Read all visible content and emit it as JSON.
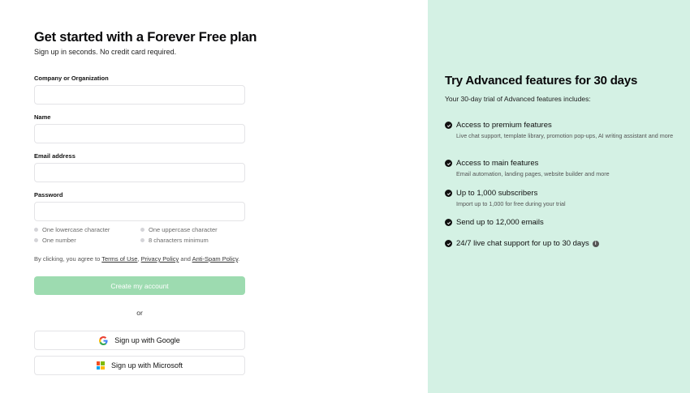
{
  "signup": {
    "title": "Get started with a Forever Free plan",
    "subtitle": "Sign up in seconds. No credit card required.",
    "fields": {
      "company": {
        "label": "Company or Organization",
        "value": "",
        "placeholder": ""
      },
      "name": {
        "label": "Name",
        "value": "",
        "placeholder": ""
      },
      "email": {
        "label": "Email address",
        "value": "",
        "placeholder": ""
      },
      "password": {
        "label": "Password",
        "value": "",
        "placeholder": ""
      }
    },
    "password_requirements": [
      "One lowercase character",
      "One uppercase character",
      "One number",
      "8 characters minimum"
    ],
    "terms": {
      "prefix": "By clicking, you agree to",
      "terms_link": "Terms of Use",
      "separator": ",",
      "privacy_link": "Privacy Policy",
      "and": "and",
      "antispam_link": "Anti-Spam Policy",
      "suffix": "."
    },
    "create_button": "Create my account",
    "or_text": "or",
    "google_button": "Sign up with Google",
    "microsoft_button": "Sign up with Microsoft",
    "icons": {
      "google": "google-icon",
      "microsoft": "microsoft-icon"
    }
  },
  "promo": {
    "title": "Try Advanced features for 30 days",
    "subtitle": "Your 30-day trial of Advanced features includes:",
    "features": [
      {
        "title": "Access to premium features",
        "desc": "Live chat support, template library, promotion pop-ups, AI writing assistant and more"
      },
      {
        "title": "Access to main features",
        "desc": "Email automation, landing pages, website builder and more"
      },
      {
        "title": "Up to 1,000 subscribers",
        "desc": "Import up to 1,000 for free during your trial"
      },
      {
        "title": "Send up to 12,000 emails",
        "desc": ""
      },
      {
        "title": "24/7 live chat support for up to 30 days",
        "desc": ""
      }
    ],
    "icons": {
      "check": "check-circle-icon",
      "info": "info-icon"
    }
  },
  "colors": {
    "accent_green": "#9ddbb0",
    "promo_background": "#d4f1e4",
    "input_border": "#e4e4e7"
  }
}
